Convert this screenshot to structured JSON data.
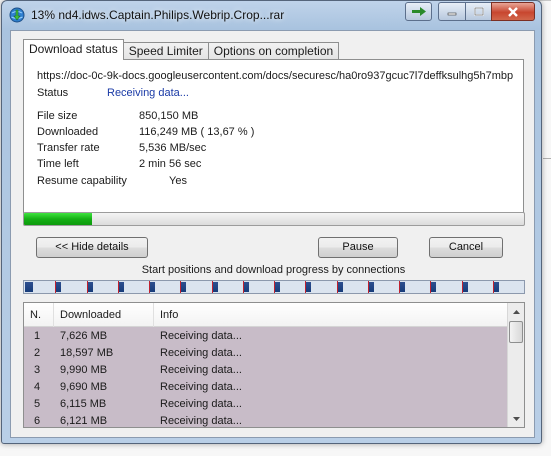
{
  "window": {
    "title": "13% nd4.idws.Captain.Philips.Webrip.Crop...rar",
    "icons": {
      "app": "download-globe-icon",
      "extra": "arrow-right-icon",
      "minimize": "minimize-icon",
      "maximize": "maximize-icon",
      "close": "close-icon"
    }
  },
  "tabs": [
    {
      "label": "Download status",
      "active": true
    },
    {
      "label": "Speed Limiter",
      "active": false
    },
    {
      "label": "Options on completion",
      "active": false
    }
  ],
  "status": {
    "url": "https://doc-0c-9k-docs.googleusercontent.com/docs/securesc/ha0ro937gcuc7l7deffksulhg5h7mbp",
    "status_label": "Status",
    "status_value": "Receiving data...",
    "file_size_label": "File size",
    "file_size_value": "850,150  MB",
    "downloaded_label": "Downloaded",
    "downloaded_value": "116,249  MB  ( 13,67 % )",
    "transfer_rate_label": "Transfer rate",
    "transfer_rate_value": "5,536  MB/sec",
    "time_left_label": "Time left",
    "time_left_value": "2 min 56 sec",
    "resume_label": "Resume capability",
    "resume_value": "Yes"
  },
  "progress": {
    "fraction": 0.1367,
    "color": "#15b015"
  },
  "buttons": {
    "hide_details": "<< Hide details",
    "pause": "Pause",
    "cancel": "Cancel"
  },
  "connections": {
    "caption": "Start positions and download progress by connections",
    "segment_color": "#1f4384",
    "marker_color": "#c0212f",
    "start_fractions": [
      0.0,
      0.0625,
      0.125,
      0.1875,
      0.25,
      0.3125,
      0.375,
      0.4375,
      0.5,
      0.5625,
      0.625,
      0.6875,
      0.75,
      0.8125,
      0.875,
      0.9375
    ]
  },
  "table": {
    "headers": {
      "n": "N.",
      "downloaded": "Downloaded",
      "info": "Info"
    },
    "rows": [
      {
        "n": "1",
        "downloaded": "7,626  MB",
        "info": "Receiving data..."
      },
      {
        "n": "2",
        "downloaded": "18,597  MB",
        "info": "Receiving data..."
      },
      {
        "n": "3",
        "downloaded": "9,990  MB",
        "info": "Receiving data..."
      },
      {
        "n": "4",
        "downloaded": "9,690  MB",
        "info": "Receiving data..."
      },
      {
        "n": "5",
        "downloaded": "6,115  MB",
        "info": "Receiving data..."
      },
      {
        "n": "6",
        "downloaded": "6,121  MB",
        "info": "Receiving data..."
      }
    ],
    "row_bg": "#c8bcc8"
  }
}
